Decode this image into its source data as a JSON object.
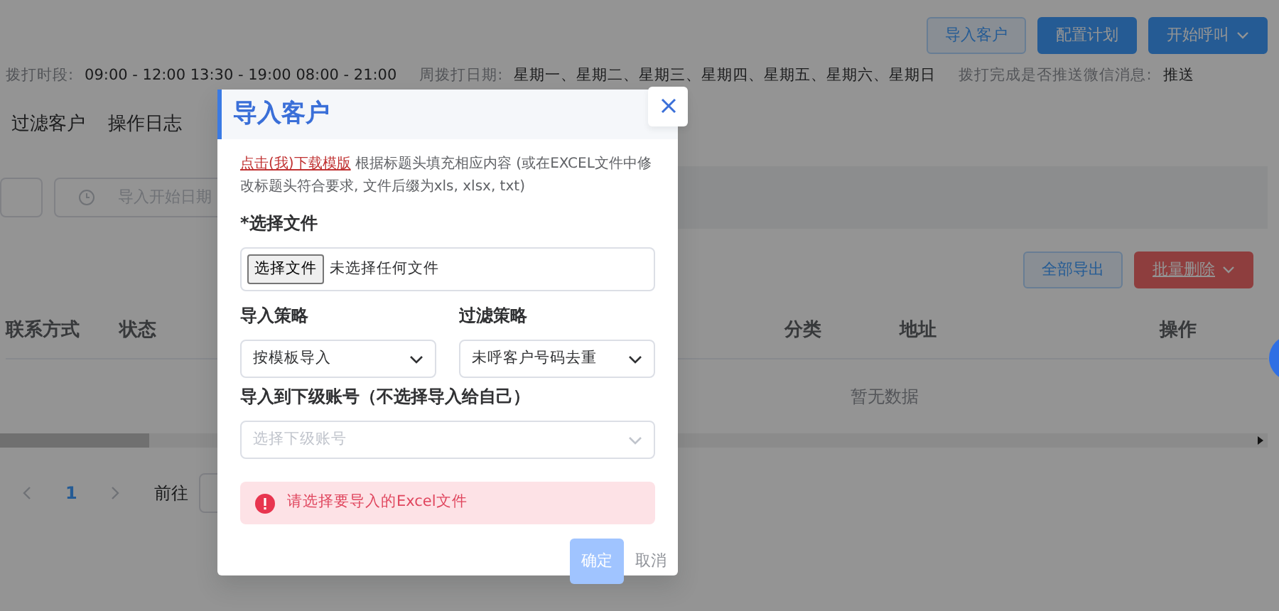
{
  "toolbar": [
    {
      "label": "导入客户",
      "kind": "outline"
    },
    {
      "label": "配置计划",
      "kind": "primary"
    },
    {
      "label": "开始呼叫",
      "kind": "dropdown"
    }
  ],
  "info": [
    {
      "label": "拨打时段:",
      "value": "09:00 - 12:00 13:30 - 19:00 08:00 - 21:00"
    },
    {
      "label": "周拨打日期:",
      "value": "星期一、星期二、星期三、星期四、星期五、星期六、星期日"
    },
    {
      "label": "拨打完成是否推送微信消息:",
      "value": "推送"
    }
  ],
  "tabs": [
    {
      "label": "过滤客户",
      "selected": false
    },
    {
      "label": "操作日志",
      "selected": false
    }
  ],
  "date_field": {
    "placeholder": "导入开始日期"
  },
  "actions": [
    {
      "label": "全部导出",
      "kind": "outline"
    },
    {
      "label": "批量删除",
      "kind": "danger-dropdown"
    }
  ],
  "table": {
    "columns": [
      "联系方式",
      "状态",
      "分类",
      "地址",
      "操作"
    ],
    "empty_text": "暂无数据"
  },
  "pagination": {
    "pages": [
      {
        "label": "1",
        "selected": true
      }
    ],
    "goto_label": "前往"
  },
  "modal": {
    "title": "导入客户",
    "notice_link": "点击(我)下载模版",
    "notice_text": "根据标题头填充相应内容 (或在EXCEL文件中修改标题头符合要求, 文件后缀为xls, xlsx, txt)",
    "file": {
      "label": "*选择文件",
      "button": "选择文件",
      "status": "未选择任何文件"
    },
    "selects": [
      {
        "label": "导入策略",
        "value": "按模板导入"
      },
      {
        "label": "过滤策略",
        "value": "未呼客户号码去重"
      }
    ],
    "account": {
      "label": "导入到下级账号（不选择导入给自己）",
      "placeholder": "选择下级账号",
      "disabled": true
    },
    "alert": "请选择要导入的Excel文件",
    "buttons": [
      {
        "label": "确定",
        "kind": "primary",
        "disabled": true
      },
      {
        "label": "取消",
        "kind": "text",
        "disabled": false
      }
    ]
  }
}
